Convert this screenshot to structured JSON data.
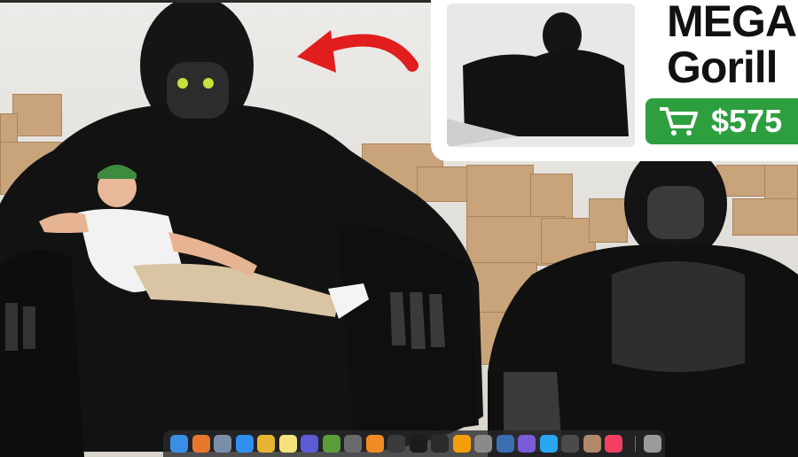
{
  "thumbnail": {
    "inset_title_line1": "MEGA",
    "inset_title_line2": "Gorill",
    "price": "$575",
    "arrow_color": "#e11d1d",
    "badge_color": "#2e9f3f"
  },
  "dock": {
    "apps": [
      {
        "name": "finder-icon",
        "color": "#3a8ee6"
      },
      {
        "name": "firefox-icon",
        "color": "#e8772e"
      },
      {
        "name": "app-icon",
        "color": "#7a8ea8"
      },
      {
        "name": "safari-icon",
        "color": "#2f8ff0"
      },
      {
        "name": "chrome-icon",
        "color": "#e6b431"
      },
      {
        "name": "notes-icon",
        "color": "#f4e27a"
      },
      {
        "name": "app-icon",
        "color": "#5b5bd6"
      },
      {
        "name": "minecraft-icon",
        "color": "#5a9e3a"
      },
      {
        "name": "app-icon",
        "color": "#6a6a6a"
      },
      {
        "name": "blender-icon",
        "color": "#f08a24"
      },
      {
        "name": "clock-icon",
        "color": "#3b3b3b"
      },
      {
        "name": "terminal-icon",
        "color": "#1c1c1c"
      },
      {
        "name": "activity-monitor-icon",
        "color": "#2b2b2b"
      },
      {
        "name": "sublime-text-icon",
        "color": "#f59e0b"
      },
      {
        "name": "app-icon",
        "color": "#8a8a8a"
      },
      {
        "name": "virtualbox-icon",
        "color": "#3a6fb0"
      },
      {
        "name": "app-icon",
        "color": "#7b5cd6"
      },
      {
        "name": "messages-icon",
        "color": "#2aa7f0"
      },
      {
        "name": "app-icon",
        "color": "#4b4b4b"
      },
      {
        "name": "app-icon",
        "color": "#b0886a"
      },
      {
        "name": "music-icon",
        "color": "#f24060"
      },
      {
        "name": "trash-icon",
        "color": "#9a9a9a"
      }
    ]
  }
}
